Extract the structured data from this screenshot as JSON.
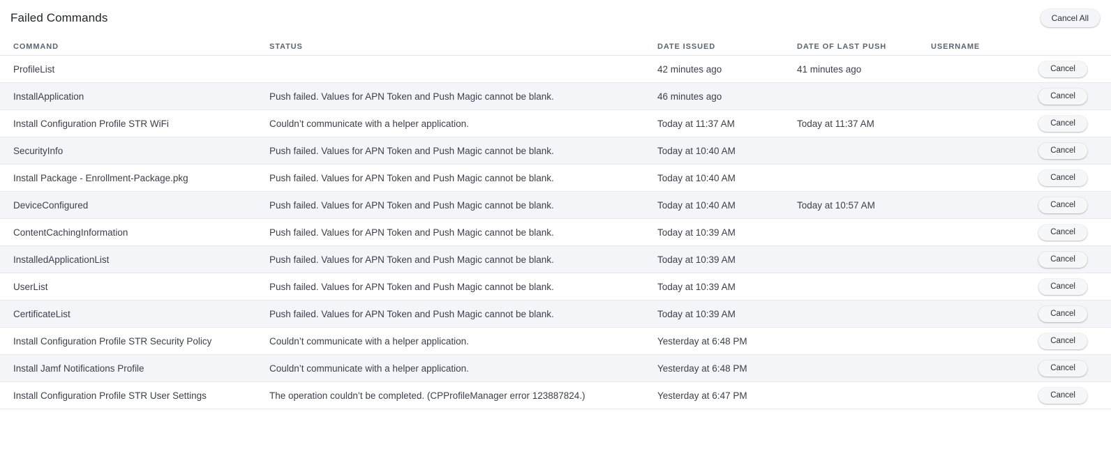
{
  "header": {
    "title": "Failed Commands",
    "cancel_all_label": "Cancel All"
  },
  "table": {
    "columns": [
      "COMMAND",
      "STATUS",
      "DATE ISSUED",
      "DATE OF LAST PUSH",
      "USERNAME"
    ],
    "cancel_label": "Cancel",
    "rows": [
      {
        "command": "ProfileList",
        "status": "",
        "date_issued": "42 minutes ago",
        "date_last_push": "41 minutes ago",
        "username": ""
      },
      {
        "command": "InstallApplication",
        "status": "Push failed. Values for APN Token and Push Magic cannot be blank.",
        "date_issued": "46 minutes ago",
        "date_last_push": "",
        "username": ""
      },
      {
        "command": "Install Configuration Profile STR WiFi",
        "status": "Couldn’t communicate with a helper application.",
        "date_issued": "Today at 11:37 AM",
        "date_last_push": "Today at 11:37 AM",
        "username": ""
      },
      {
        "command": "SecurityInfo",
        "status": "Push failed. Values for APN Token and Push Magic cannot be blank.",
        "date_issued": "Today at 10:40 AM",
        "date_last_push": "",
        "username": ""
      },
      {
        "command": "Install Package - Enrollment-Package.pkg",
        "status": "Push failed. Values for APN Token and Push Magic cannot be blank.",
        "date_issued": "Today at 10:40 AM",
        "date_last_push": "",
        "username": ""
      },
      {
        "command": "DeviceConfigured",
        "status": "Push failed. Values for APN Token and Push Magic cannot be blank.",
        "date_issued": "Today at 10:40 AM",
        "date_last_push": "Today at 10:57 AM",
        "username": ""
      },
      {
        "command": "ContentCachingInformation",
        "status": "Push failed. Values for APN Token and Push Magic cannot be blank.",
        "date_issued": "Today at 10:39 AM",
        "date_last_push": "",
        "username": ""
      },
      {
        "command": "InstalledApplicationList",
        "status": "Push failed. Values for APN Token and Push Magic cannot be blank.",
        "date_issued": "Today at 10:39 AM",
        "date_last_push": "",
        "username": ""
      },
      {
        "command": "UserList",
        "status": "Push failed. Values for APN Token and Push Magic cannot be blank.",
        "date_issued": "Today at 10:39 AM",
        "date_last_push": "",
        "username": ""
      },
      {
        "command": "CertificateList",
        "status": "Push failed. Values for APN Token and Push Magic cannot be blank.",
        "date_issued": "Today at 10:39 AM",
        "date_last_push": "",
        "username": ""
      },
      {
        "command": "Install Configuration Profile STR Security Policy",
        "status": "Couldn’t communicate with a helper application.",
        "date_issued": "Yesterday at 6:48 PM",
        "date_last_push": "",
        "username": ""
      },
      {
        "command": "Install Jamf Notifications Profile",
        "status": "Couldn’t communicate with a helper application.",
        "date_issued": "Yesterday at 6:48 PM",
        "date_last_push": "",
        "username": ""
      },
      {
        "command": "Install Configuration Profile STR User Settings",
        "status": "The operation couldn’t be completed. (CPProfileManager error 123887824.)",
        "date_issued": "Yesterday at 6:47 PM",
        "date_last_push": "",
        "username": ""
      }
    ]
  }
}
